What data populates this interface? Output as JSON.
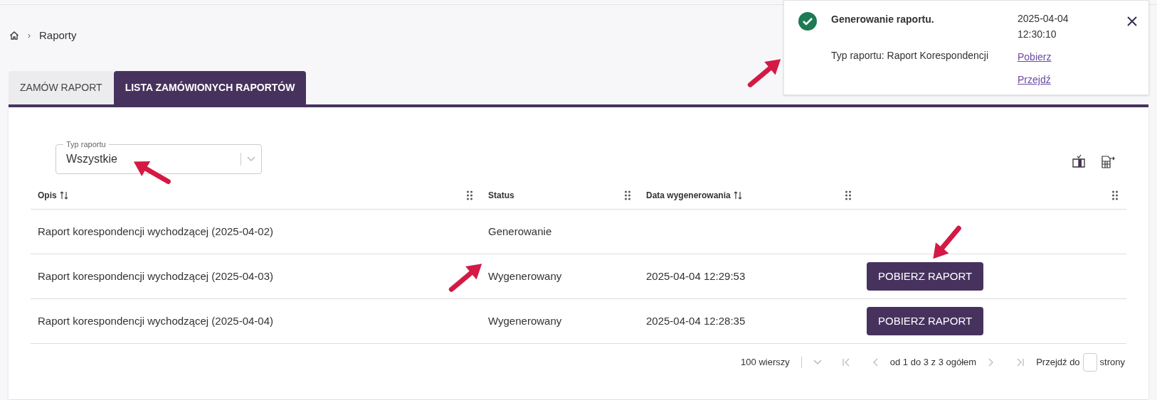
{
  "breadcrumb": {
    "separator": "›",
    "current": "Raporty"
  },
  "tabs": [
    {
      "label": "ZAMÓW RAPORT",
      "selected": false
    },
    {
      "label": "LISTA ZAMÓWIONYCH RAPORTÓW",
      "selected": true
    }
  ],
  "filter": {
    "label": "Typ raportu",
    "value": "Wszystkie"
  },
  "table": {
    "columns": [
      {
        "label": "Opis",
        "sortable": true
      },
      {
        "label": "Status",
        "sortable": false
      },
      {
        "label": "Data wygenerowania",
        "sortable": true
      },
      {
        "sortable": false
      }
    ],
    "rows": [
      {
        "description": "Raport korespondencji wychodzącej (2025-04-02)",
        "status": "Generowanie"
      },
      {
        "description": "Raport korespondencji wychodzącej (2025-04-03)",
        "status": "Wygenerowany",
        "date": "2025-04-04 12:29:53",
        "action": "POBIERZ RAPORT"
      },
      {
        "description": "Raport korespondencji wychodzącej (2025-04-04)",
        "status": "Wygenerowany",
        "date": "2025-04-04 12:28:35",
        "action": "POBIERZ RAPORT"
      }
    ]
  },
  "pagination": {
    "page_size": "100 wierszy",
    "range": "od 1 do 3 z 3 ogółem",
    "goto_label": "Przejdź do",
    "goto_suffix": "strony",
    "first_disabled": true,
    "prev_disabled": true,
    "next_disabled": true,
    "last_disabled": true
  },
  "toast": {
    "title": "Generowanie raportu.",
    "date": "2025-04-04",
    "time": "12:30:10",
    "message": "Typ raportu: Raport Korespondencji",
    "links": [
      "Pobierz",
      "Przejdź"
    ]
  }
}
